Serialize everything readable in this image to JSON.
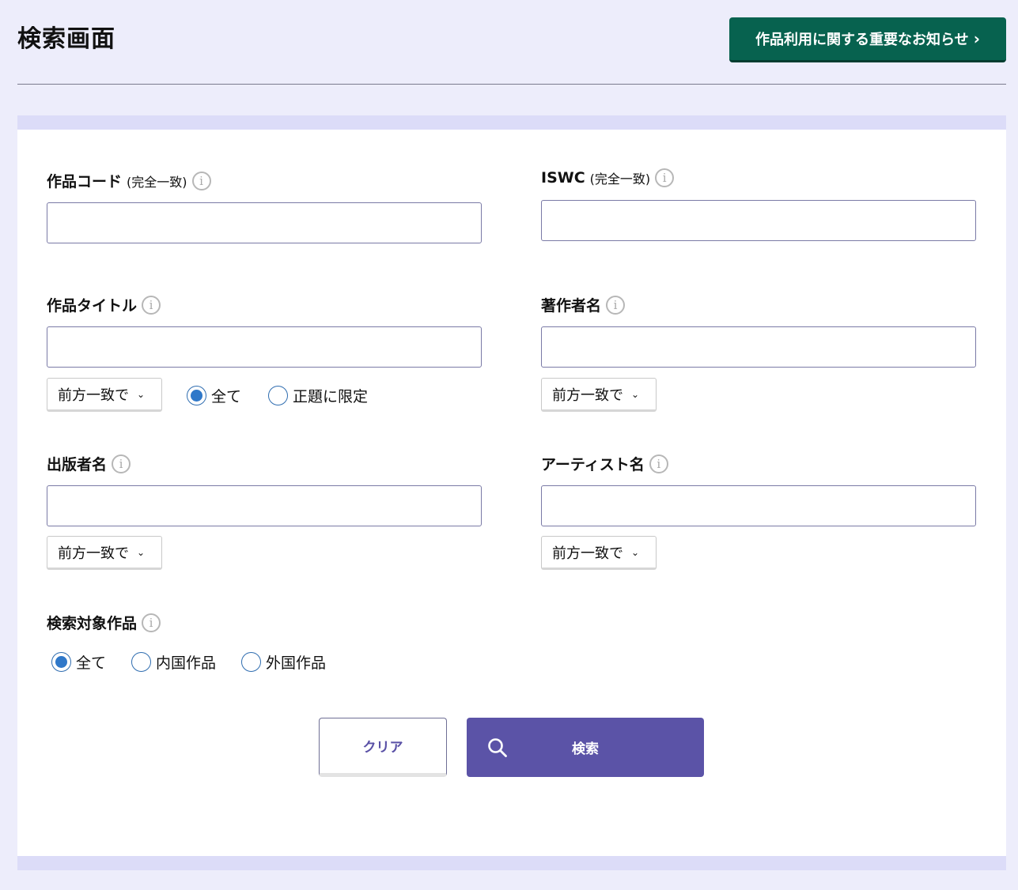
{
  "header": {
    "title": "検索画面",
    "notice_button": "作品利用に関する重要なお知らせ",
    "notice_chevron": "›"
  },
  "info_glyph": "i",
  "fields": {
    "work_code": {
      "label": "作品コード",
      "note": "(完全一致)",
      "value": ""
    },
    "iswc": {
      "label": "ISWC",
      "note": "(完全一致)",
      "value": ""
    },
    "work_title": {
      "label": "作品タイトル",
      "value": "",
      "match_select": "前方一致で"
    },
    "author": {
      "label": "著作者名",
      "value": "",
      "match_select": "前方一致で"
    },
    "publisher": {
      "label": "出版者名",
      "value": "",
      "match_select": "前方一致で"
    },
    "artist": {
      "label": "アーティスト名",
      "value": "",
      "match_select": "前方一致で"
    }
  },
  "title_scope": {
    "options": [
      "全て",
      "正題に限定"
    ],
    "selected": "全て"
  },
  "search_target": {
    "label": "検索対象作品",
    "options": [
      "全て",
      "内国作品",
      "外国作品"
    ],
    "selected": "全て"
  },
  "actions": {
    "clear_label": "クリア",
    "search_label": "検索"
  },
  "icons": {
    "info": "info-icon",
    "caret": "chevron-down-icon",
    "search": "search-icon"
  },
  "colors": {
    "background": "#ededfb",
    "notice_button": "#07624f",
    "search_button": "#5b53a7",
    "radio_checked": "#2f78c9"
  }
}
